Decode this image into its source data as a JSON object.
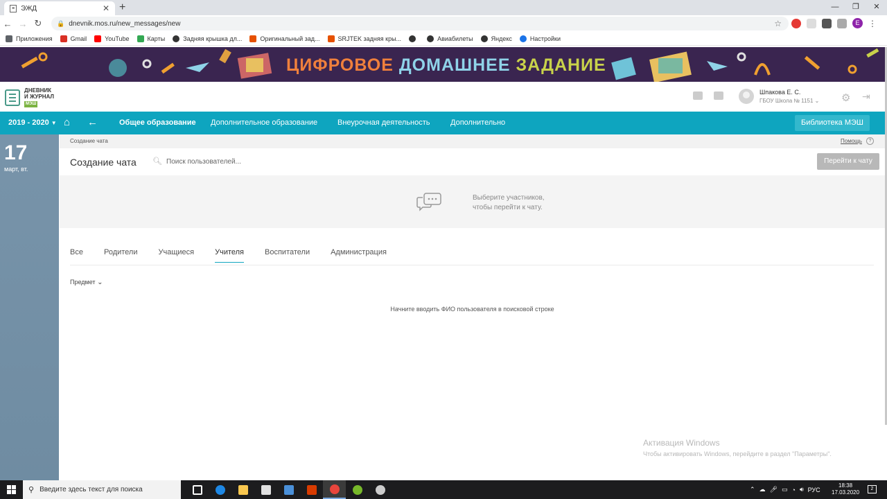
{
  "browser": {
    "tab_title": "ЭЖД",
    "tab_icon": "diary-icon",
    "url": "dnevnik.mos.ru/new_messages/new",
    "profile_letter": "E",
    "bookmarks": [
      {
        "label": "Приложения",
        "icon": "apps-grid-icon",
        "color": "#5f6368"
      },
      {
        "label": "Gmail",
        "icon": "gmail-icon",
        "color": "#d93025"
      },
      {
        "label": "YouTube",
        "icon": "youtube-icon",
        "color": "#ff0000"
      },
      {
        "label": "Карты",
        "icon": "maps-icon",
        "color": "#34a853"
      },
      {
        "label": "Задняя крышка дл...",
        "icon": "globe-icon",
        "color": "#333333"
      },
      {
        "label": "Оригинальный зад...",
        "icon": "shop-icon",
        "color": "#e65100"
      },
      {
        "label": "SRJTEK задняя кры...",
        "icon": "shop-icon",
        "color": "#e65100"
      },
      {
        "label": "",
        "icon": "globe-icon",
        "color": "#333333"
      },
      {
        "label": "Авиабилеты",
        "icon": "globe-icon",
        "color": "#333333"
      },
      {
        "label": "Яндекс",
        "icon": "globe-icon",
        "color": "#333333"
      },
      {
        "label": "Настройки",
        "icon": "gear-icon",
        "color": "#1a73e8"
      }
    ]
  },
  "banner": {
    "word1": "ЦИФРОВОЕ",
    "word2": "ДОМАШНЕЕ",
    "word3": "ЗАДАНИЕ"
  },
  "header": {
    "logo_line1": "ДНЕВНИК",
    "logo_line2": "И ЖУРНАЛ",
    "logo_badge": "МЭШ",
    "user_name": "Шпакова Е. С.",
    "user_school": "ГБОУ Школа № 1151"
  },
  "nav": {
    "year": "2019 - 2020",
    "items": [
      {
        "label": "Общее образование",
        "active": true
      },
      {
        "label": "Дополнительное образование",
        "active": false
      },
      {
        "label": "Внеурочная деятельность",
        "active": false
      },
      {
        "label": "Дополнительно",
        "active": false
      }
    ],
    "library": "Библиотека МЭШ"
  },
  "sidebar": {
    "day": "17",
    "month": "март, вт."
  },
  "content": {
    "breadcrumb": "Создание чата",
    "help": "Помощь",
    "title": "Создание чата",
    "search_placeholder": "Поиск пользователей...",
    "goto_button": "Перейти к чату",
    "empty_line1": "Выберите участников,",
    "empty_line2": "чтобы перейти к чату.",
    "tabs": [
      "Все",
      "Родители",
      "Учащиеся",
      "Учителя",
      "Воспитатели",
      "Администрация"
    ],
    "active_tab": "Учителя",
    "subject_filter": "Предмет",
    "hint": "Начните вводить ФИО пользователя в поисковой строке"
  },
  "watermark": {
    "title": "Активация Windows",
    "subtitle": "Чтобы активировать Windows, перейдите в раздел \"Параметры\"."
  },
  "taskbar": {
    "search_placeholder": "Введите здесь текст для поиска",
    "lang": "РУС",
    "time": "18:38",
    "date": "17.03.2020",
    "notifications": "2",
    "apps": [
      {
        "name": "task-view-icon",
        "color": "#ffffff"
      },
      {
        "name": "edge-icon",
        "color": "#1e88e5"
      },
      {
        "name": "explorer-icon",
        "color": "#f9c74f"
      },
      {
        "name": "store-icon",
        "color": "#e0e0e0"
      },
      {
        "name": "mail-icon",
        "color": "#4a90d9"
      },
      {
        "name": "office-icon",
        "color": "#d83b01"
      },
      {
        "name": "chrome-icon",
        "color": "#e8453c"
      },
      {
        "name": "torrent-icon",
        "color": "#77b82a"
      },
      {
        "name": "gauge-icon",
        "color": "#cccccc"
      }
    ]
  }
}
